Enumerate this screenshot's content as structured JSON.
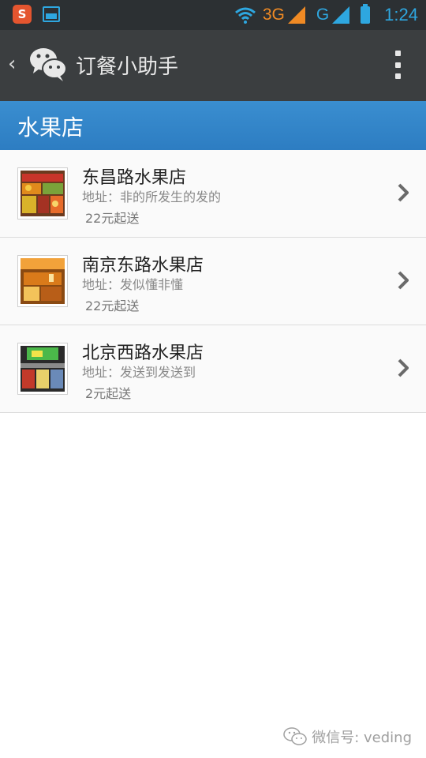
{
  "status_bar": {
    "app_icon_letter": "S",
    "network_3g": "3G",
    "network_g": "G",
    "time": "1:24",
    "icons": [
      "sogou-input-icon",
      "image-notification-icon",
      "wifi-icon",
      "signal-icon",
      "battery-icon"
    ]
  },
  "action_bar": {
    "title": "订餐小助手",
    "back_icon": "‹"
  },
  "section": {
    "title": "水果店"
  },
  "shops": [
    {
      "name": "东昌路水果店",
      "address": "地址：非的所发生的发的",
      "min_order": "22元起送"
    },
    {
      "name": "南京东路水果店",
      "address": "地址：发似懂非懂",
      "min_order": "22元起送"
    },
    {
      "name": "北京西路水果店",
      "address": "地址：发送到发送到",
      "min_order": "2元起送"
    }
  ],
  "watermark": {
    "text": "微信号: veding"
  },
  "colors": {
    "status_bar_bg": "#2c3033",
    "action_bar_bg": "#3b3e40",
    "section_bg": "#3a8ed0",
    "accent_orange": "#f08a24",
    "accent_blue": "#2ea7e0"
  }
}
